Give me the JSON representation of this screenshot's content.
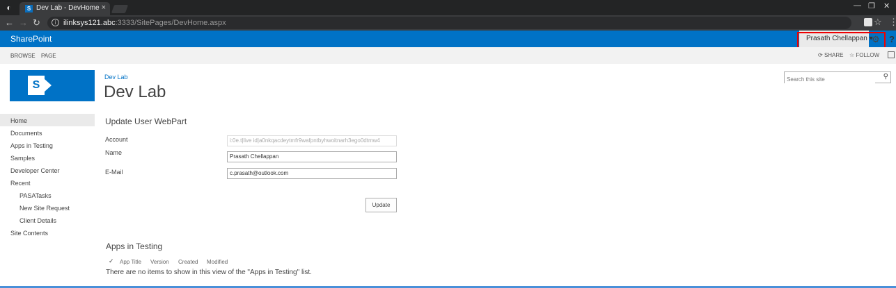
{
  "browser": {
    "tab_title": "Dev Lab - DevHome",
    "url_host": "ilinksys121.abc",
    "url_rest": ":3333/SitePages/DevHome.aspx"
  },
  "suitebar": {
    "brand": "SharePoint",
    "user": "Prasath Chellappan",
    "colors": {
      "suitebar": "#0072c6",
      "highlight": "#e00000"
    }
  },
  "ribbon": {
    "browse": "BROWSE",
    "page": "PAGE",
    "share": "SHARE",
    "follow": "FOLLOW"
  },
  "site": {
    "breadcrumb": "Dev Lab",
    "title": "Dev Lab",
    "search_placeholder": "Search this site"
  },
  "quicklaunch": {
    "home": "Home",
    "documents": "Documents",
    "apps_in_testing": "Apps in Testing",
    "samples": "Samples",
    "developer_center": "Developer Center",
    "recent": "Recent",
    "pasatasks": "PASATasks",
    "new_site_request": "New Site Request",
    "client_details": "Client Details",
    "site_contents": "Site Contents"
  },
  "webpart": {
    "title": "Update User WebPart",
    "account_label": "Account",
    "account_value": "i:0e.t|live id|a0nkqacdeytmfr9wafpntbyhwoitnarh3ego0dtmw4",
    "name_label": "Name",
    "name_value": "Prasath Chellappan",
    "email_label": "E-Mail",
    "email_value": "c.prasath@outlook.com",
    "update_button": "Update"
  },
  "list": {
    "title": "Apps in Testing",
    "columns": [
      "App Title",
      "Version",
      "Created",
      "Modified"
    ],
    "empty_message": "There are no items to show in this view of the \"Apps in Testing\" list."
  }
}
